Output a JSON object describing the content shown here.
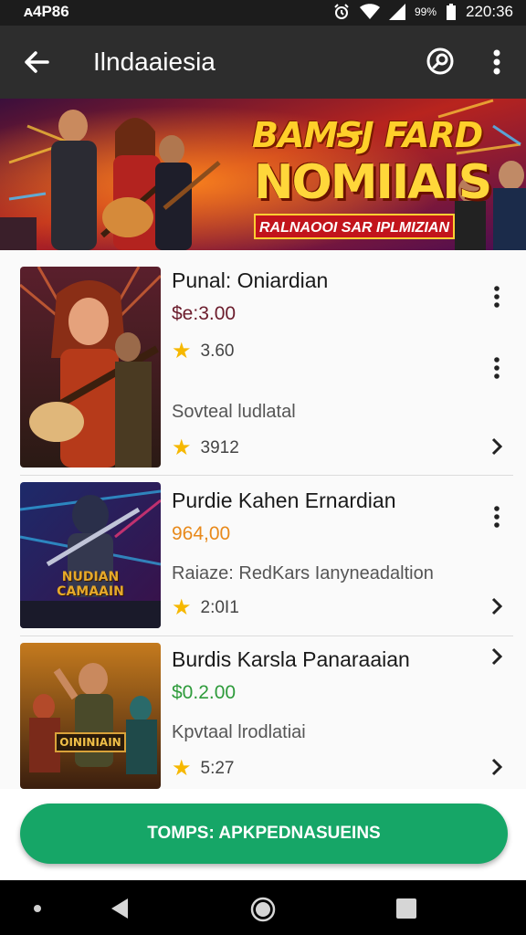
{
  "status_bar": {
    "left_text": "ᴀ4P86",
    "battery_text": "99%",
    "time": "220:36"
  },
  "app_bar": {
    "title": "Ilndaaiesia"
  },
  "banner": {
    "title_line1": "BAMꞨJ FARD",
    "title_line2": "NOMIIAIS",
    "subtitle": "RALNAOOI SAR IPLMIZIAN"
  },
  "list": [
    {
      "name": "Punal: Oniardian",
      "price": "$e:3.00",
      "rating_top": "3.60",
      "desc": "Sovteal ludlatal",
      "rating_bottom": "3912",
      "thumb_caption": ""
    },
    {
      "name": "Purdie Kahen Ernardian",
      "price": "964,00",
      "desc": "Raiaze: RedKars Ianyneadaltion",
      "rating": "2:0I1",
      "thumb_caption_1": "NUDIAN",
      "thumb_caption_2": "CAMAAIN"
    },
    {
      "name": "Burdis Karsla Panaraaian",
      "price": "$0.2.00",
      "desc": "Kpvtaal lrodlatiai",
      "rating": "5:27",
      "thumb_caption": "OININIAIN"
    }
  ],
  "colors": {
    "price_1": "#6b1c2c",
    "price_2": "#e8891a",
    "price_3": "#2e9b3b",
    "cta": "#16a667"
  },
  "cta": {
    "label": "TOMPS: APKPEDNASUEINS"
  }
}
